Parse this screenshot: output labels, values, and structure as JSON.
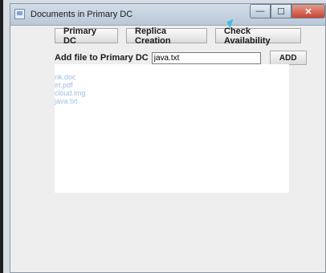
{
  "window": {
    "title": "Documents in Primary DC"
  },
  "window_controls": {
    "min": "—",
    "max": "☐",
    "close": "✕"
  },
  "toolbar": {
    "primary_dc": "Primary DC",
    "replica_creation": "Replica Creation",
    "check_availability": "Check Availability"
  },
  "add_row": {
    "label": "Add file to Primary DC",
    "file_value": "java.txt",
    "add_button": "ADD"
  },
  "files": [
    "nk.doc",
    "irt.pdf",
    "cloud.img",
    "java.txt"
  ]
}
